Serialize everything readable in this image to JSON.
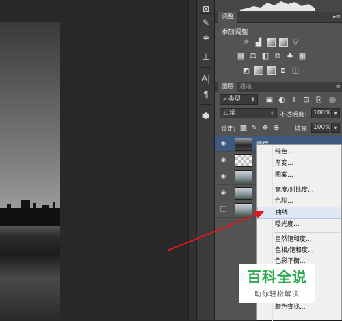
{
  "adjustments_panel": {
    "tabs": [
      "调整"
    ],
    "title": "添加调整"
  },
  "layers_panel": {
    "tabs": [
      "图层",
      "通道"
    ],
    "filter_kind": "类型",
    "blend_mode": "正常",
    "opacity_label": "不透明度:",
    "opacity_value": "100%",
    "lock_label": "锁定:",
    "fill_label": "填充:",
    "fill_value": "100%",
    "first_layer_name": "图层"
  },
  "context_menu": {
    "items": [
      "纯色...",
      "渐变...",
      "图案...",
      "亮度/对比度...",
      "色阶...",
      "曲线...",
      "曝光度...",
      "自然饱和度...",
      "色相/饱和度...",
      "色彩平衡...",
      "颜色查找..."
    ],
    "highlighted": "曲线..."
  },
  "watermark": {
    "logo": "百科全说",
    "sub": "助你轻松解决"
  },
  "colors": {
    "accent_arrow": "#e01818",
    "watermark_green": "#29a94d",
    "menu_highlight": "#dfe9f5"
  },
  "icons": [
    "filter-icon",
    "brightness-icon",
    "levels-icon",
    "curves-icon",
    "exposure-icon",
    "vibrance-icon",
    "eye-icon",
    "lock-icon",
    "brush-icon",
    "move-icon",
    "text-icon",
    "paragraph-icon",
    "cube-icon",
    "menu-icon"
  ]
}
